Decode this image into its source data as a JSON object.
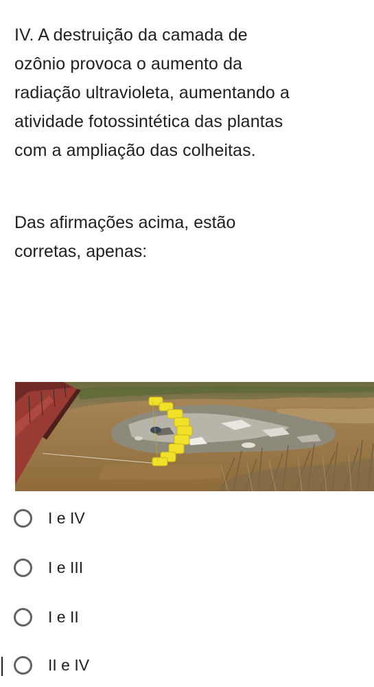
{
  "question": {
    "statement_lines": [
      "IV. A destruição da camada de",
      "ozônio provoca o aumento da",
      "radiação ultravioleta, aumentando a",
      "atividade fotossintética das plantas",
      "com a ampliação das colheitas."
    ],
    "prompt_lines": [
      "Das afirmações acima, estão",
      "corretas, apenas:"
    ]
  },
  "options": [
    {
      "label": "I e IV"
    },
    {
      "label": "I e III"
    },
    {
      "label": "I e II"
    },
    {
      "label": "II e IV"
    }
  ],
  "colors": {
    "text": "#202124",
    "radio_border": "#5f6368",
    "water": "#9b7a45",
    "boom_yellow": "#f2e12a",
    "barge_red": "#9a3b33"
  }
}
